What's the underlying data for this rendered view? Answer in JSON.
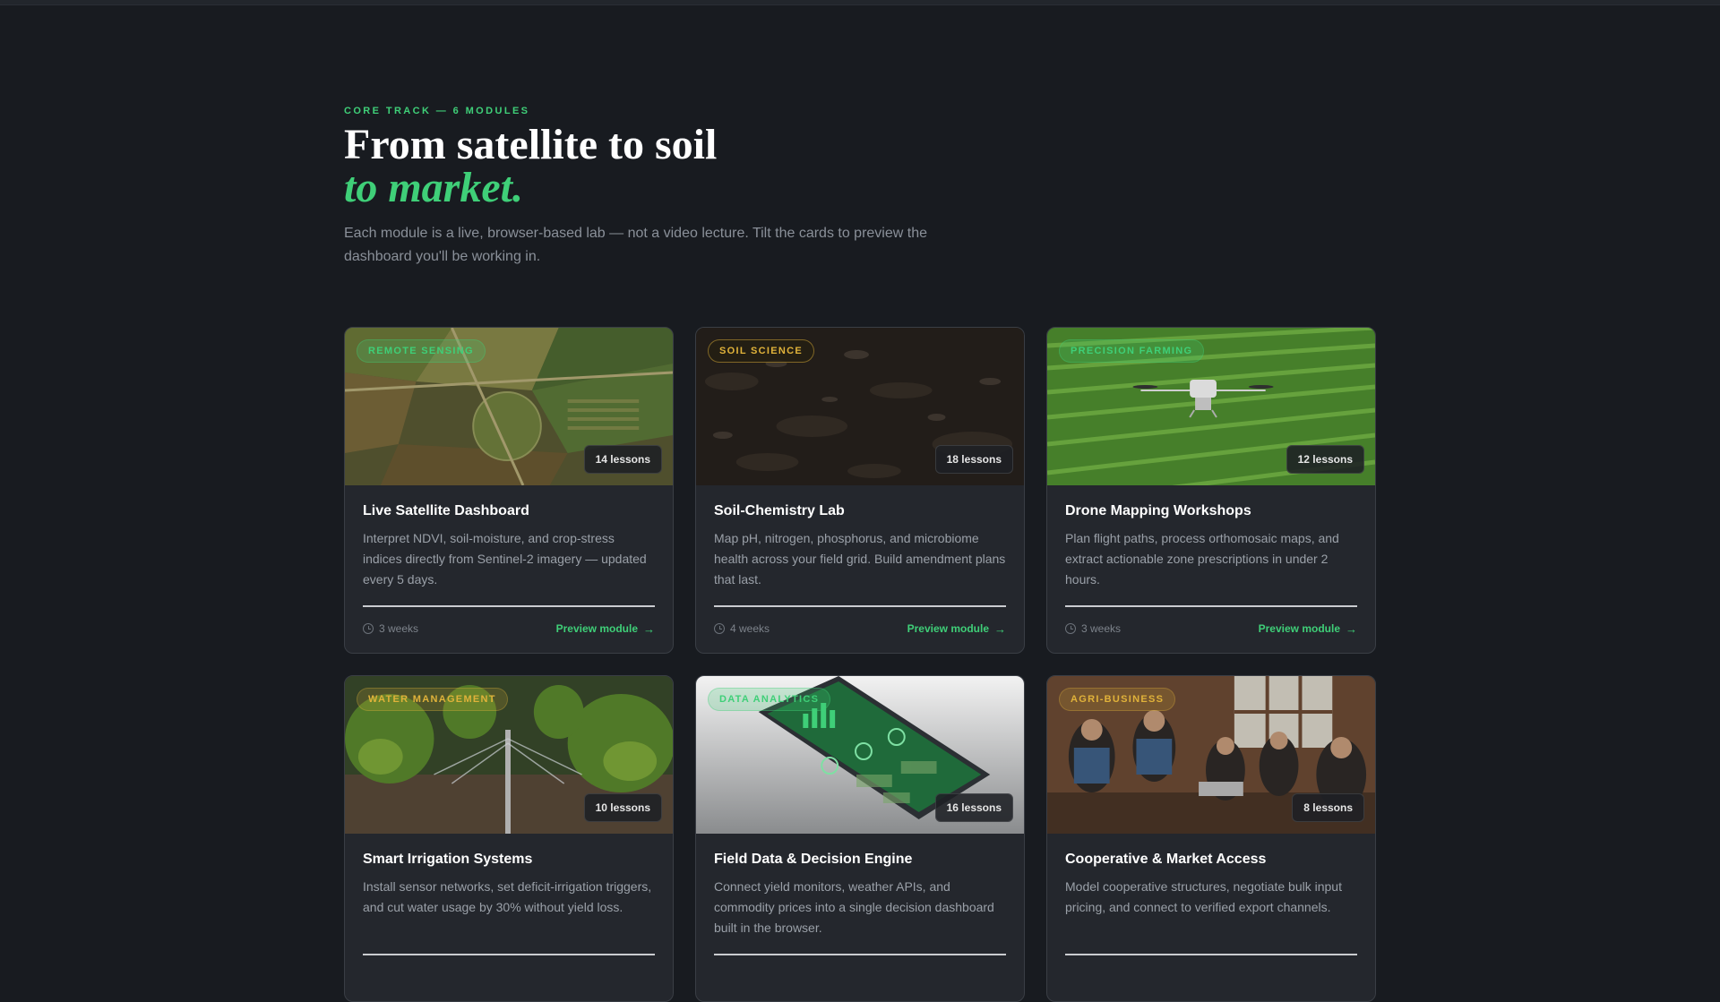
{
  "section": {
    "eyebrow": "CORE TRACK — 6 MODULES",
    "headline_line1": "From satellite to soil",
    "headline_line2": "to market.",
    "lede": "Each module is a live, browser-based lab — not a video lecture. Tilt the cards to preview the dashboard you'll be working in."
  },
  "colors": {
    "background": "#181b20",
    "card": "#24272d",
    "accent_green": "#3fcf78",
    "accent_gold": "#e0b23a"
  },
  "modules": [
    {
      "tag": "REMOTE SENSING",
      "lessons": "14 lessons",
      "title": "Live Satellite Dashboard",
      "desc": "Interpret NDVI, soil-moisture, and crop-stress indices directly from Sentinel-2 imagery — updated every 5 days.",
      "duration": "3 weeks",
      "cta": "Preview module"
    },
    {
      "tag": "SOIL SCIENCE",
      "lessons": "18 lessons",
      "title": "Soil-Chemistry Lab",
      "desc": "Map pH, nitrogen, phosphorus, and microbiome health across your field grid. Build amendment plans that last.",
      "duration": "4 weeks",
      "cta": "Preview module"
    },
    {
      "tag": "PRECISION FARMING",
      "lessons": "12 lessons",
      "title": "Drone Mapping Workshops",
      "desc": "Plan flight paths, process orthomosaic maps, and extract actionable zone prescriptions in under 2 hours.",
      "duration": "3 weeks",
      "cta": "Preview module"
    },
    {
      "tag": "WATER MANAGEMENT",
      "lessons": "10 lessons",
      "title": "Smart Irrigation Systems",
      "desc": "Install sensor networks, set deficit-irrigation triggers, and cut water usage by 30% without yield loss.",
      "duration": "",
      "cta": ""
    },
    {
      "tag": "DATA ANALYTICS",
      "lessons": "16 lessons",
      "title": "Field Data & Decision Engine",
      "desc": "Connect yield monitors, weather APIs, and commodity prices into a single decision dashboard built in the browser.",
      "duration": "",
      "cta": ""
    },
    {
      "tag": "AGRI-BUSINESS",
      "lessons": "8 lessons",
      "title": "Cooperative & Market Access",
      "desc": "Model cooperative structures, negotiate bulk input pricing, and connect to verified export channels.",
      "duration": "",
      "cta": ""
    }
  ],
  "icons": {
    "duration": "clock-icon",
    "cta": "arrow-right-icon"
  }
}
